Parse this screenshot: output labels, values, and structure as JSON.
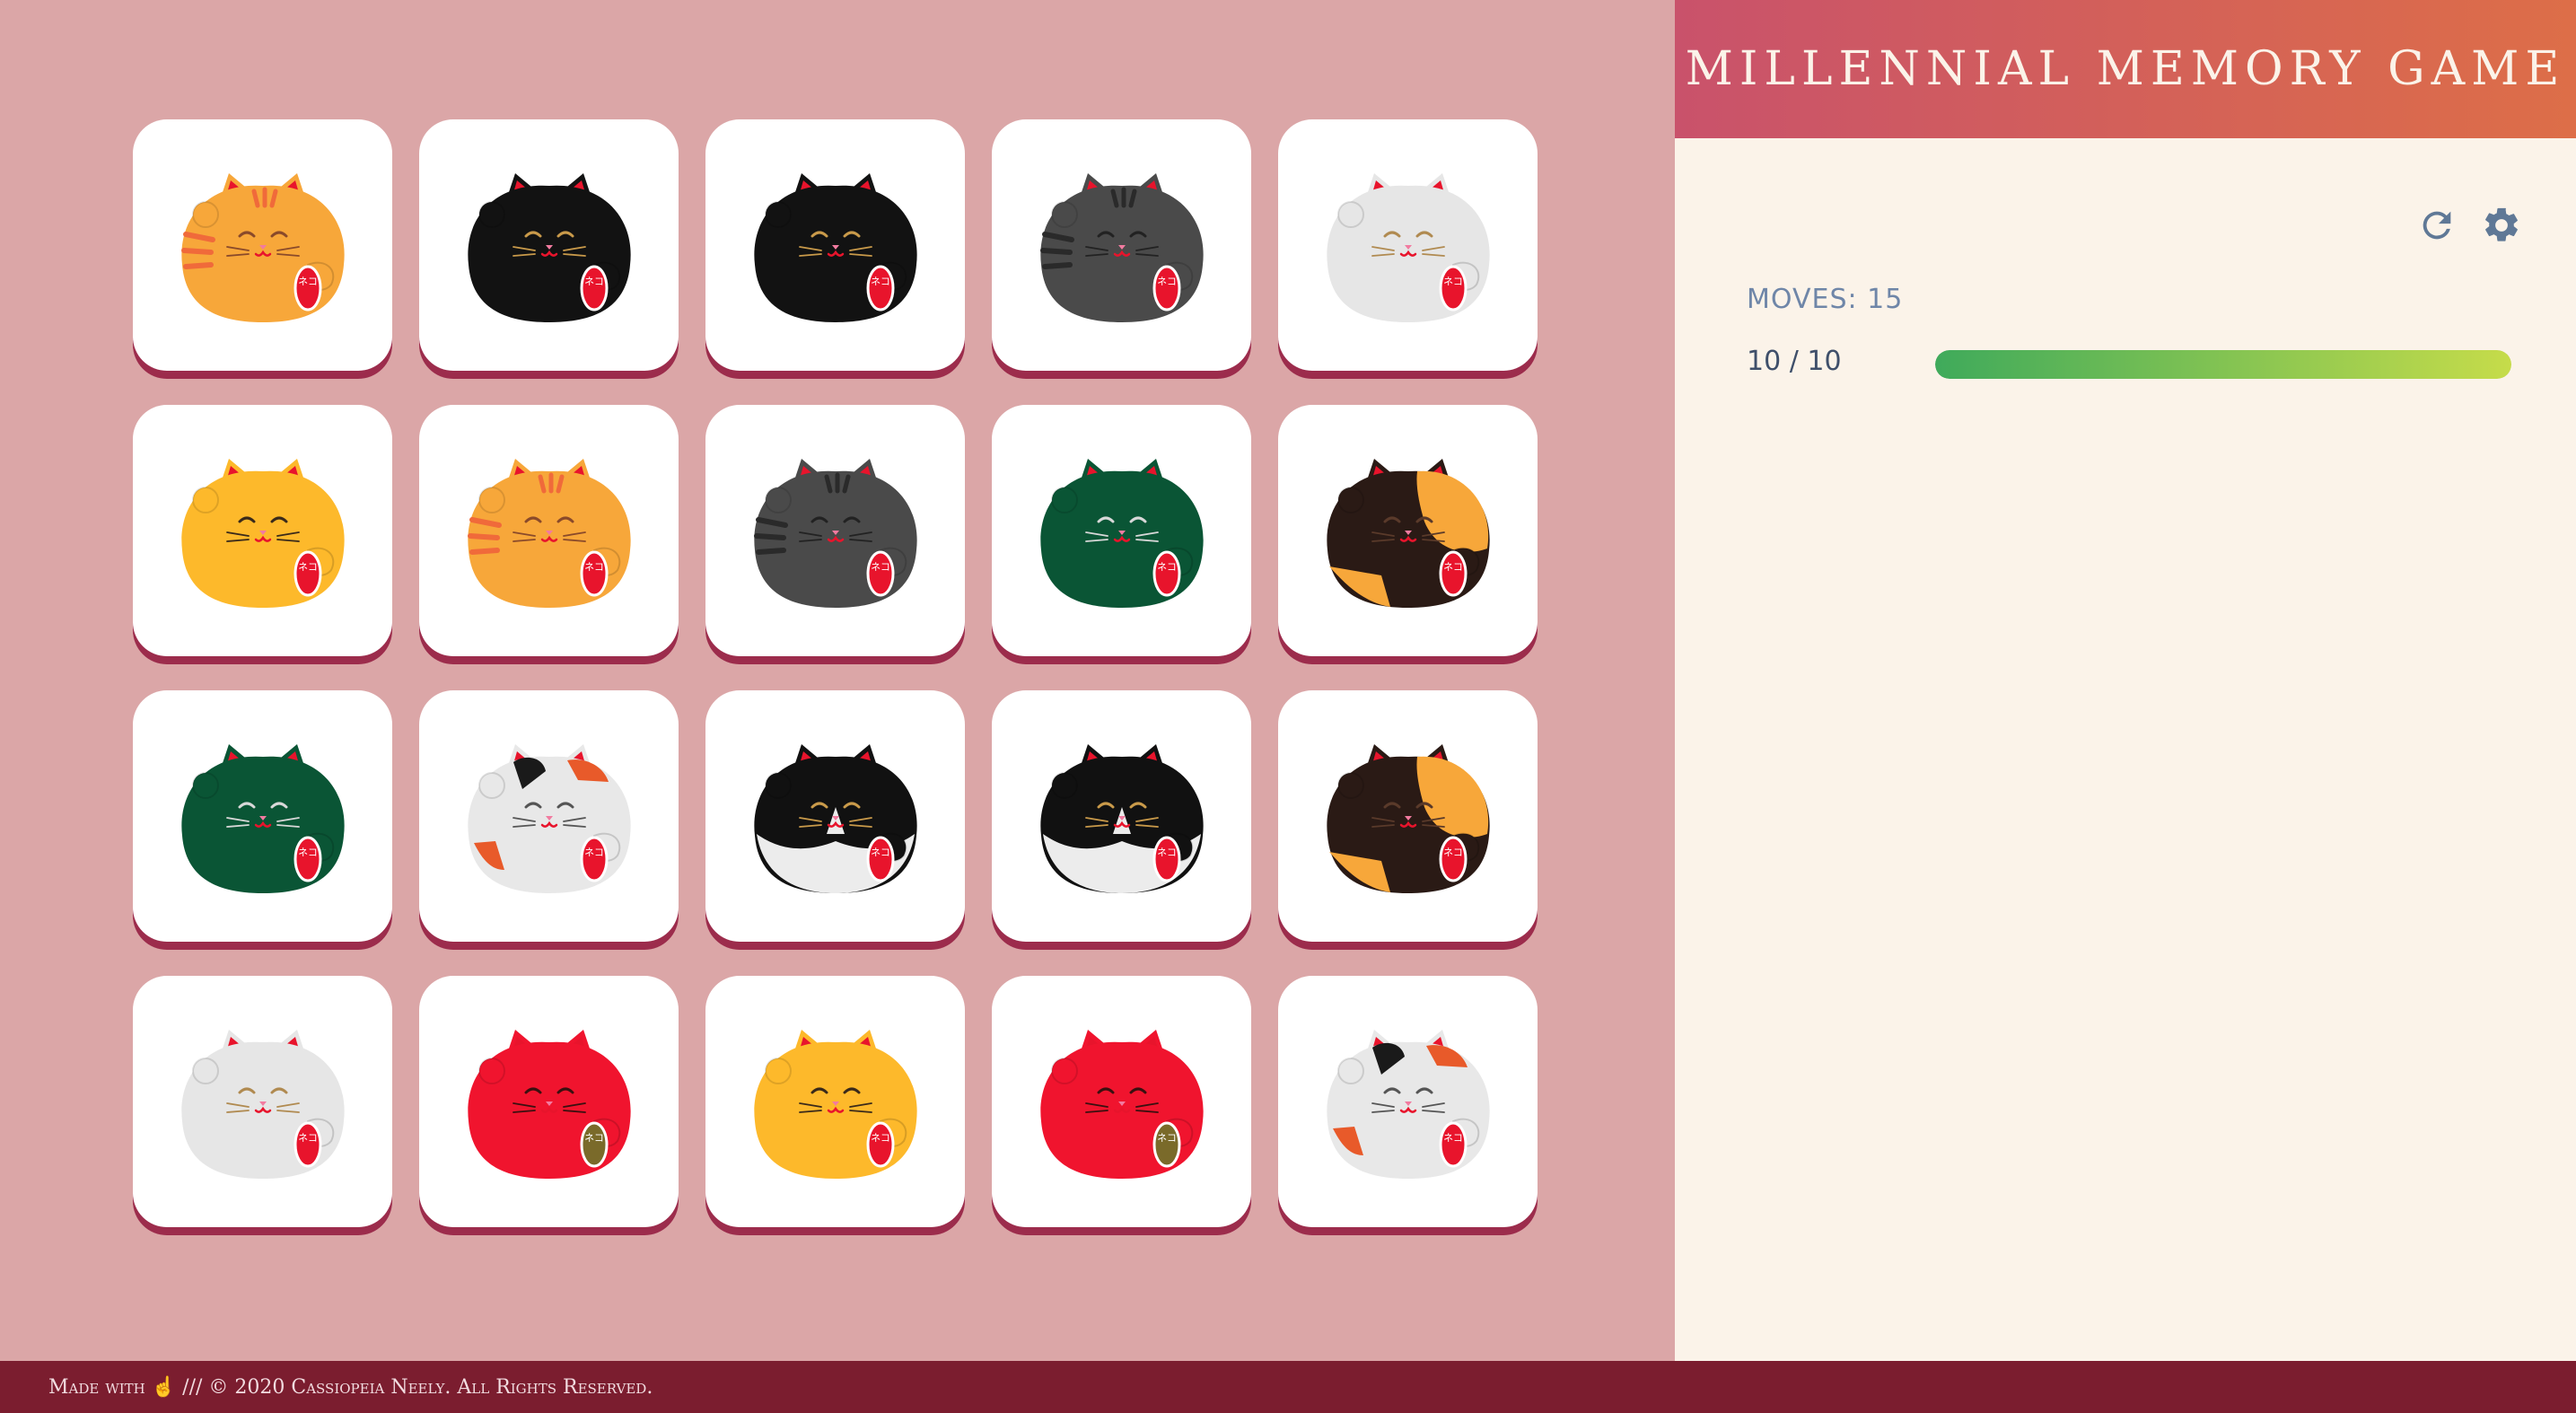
{
  "header": {
    "title": "Millennial Memory Game"
  },
  "controls": {
    "restart_icon": "restart-icon",
    "settings_icon": "gear-icon"
  },
  "stats": {
    "moves_label": "MOVES:",
    "moves_value": "15",
    "progress_text": "10 / 10",
    "progress_fraction": 1.0
  },
  "footer": {
    "made_with": "Made with",
    "hand": "☝",
    "rest": "/// © 2020 Cassiopeia Neely. All Rights Reserved."
  },
  "badge_text": "ネコ",
  "cards": [
    {
      "cat": "orange-tabby"
    },
    {
      "cat": "black"
    },
    {
      "cat": "black"
    },
    {
      "cat": "gray-tabby"
    },
    {
      "cat": "white"
    },
    {
      "cat": "yellow"
    },
    {
      "cat": "orange-tabby"
    },
    {
      "cat": "gray-tabby"
    },
    {
      "cat": "green"
    },
    {
      "cat": "calico-dark"
    },
    {
      "cat": "green"
    },
    {
      "cat": "calico"
    },
    {
      "cat": "tuxedo"
    },
    {
      "cat": "tuxedo"
    },
    {
      "cat": "calico-dark"
    },
    {
      "cat": "white"
    },
    {
      "cat": "red"
    },
    {
      "cat": "yellow"
    },
    {
      "cat": "red"
    },
    {
      "cat": "calico"
    }
  ],
  "palette": {
    "orange-tabby": {
      "body": "#f7a73a",
      "stripe": "#f06a3a",
      "face": "#8a4a2a",
      "badge": "#e8142c"
    },
    "black": {
      "body": "#121212",
      "stripe": "none",
      "face": "#c99a4a",
      "badge": "#e8142c"
    },
    "gray-tabby": {
      "body": "#4a4a4a",
      "stripe": "#2a2a2a",
      "face": "#222222",
      "badge": "#e8142c"
    },
    "white": {
      "body": "#e6e6e6",
      "stripe": "none",
      "face": "#b08a50",
      "badge": "#e8142c"
    },
    "yellow": {
      "body": "#fdb92b",
      "stripe": "none",
      "face": "#3a2a1a",
      "badge": "#e8142c"
    },
    "green": {
      "body": "#0a5535",
      "stripe": "none",
      "face": "#d8d8d8",
      "badge": "#e8142c"
    },
    "calico-dark": {
      "body": "#2a1a15",
      "stripe": "#f7a73a",
      "face": "#5a3a2a",
      "badge": "#e8142c"
    },
    "calico": {
      "body": "#e8e8e8",
      "stripe": "#1a1a1a",
      "face": "#555555",
      "badge": "#e8142c"
    },
    "tuxedo": {
      "body": "#111111",
      "stripe": "#ffffff",
      "face": "#c99a4a",
      "badge": "#e8142c"
    },
    "red": {
      "body": "#f0142e",
      "stripe": "none",
      "face": "#3a1010",
      "badge": "#7a6a2a"
    }
  }
}
